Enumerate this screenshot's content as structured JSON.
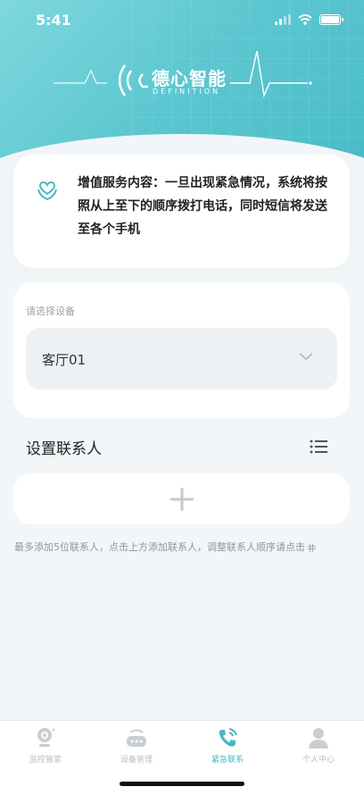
{
  "status_bar": {
    "time": "5:41"
  },
  "brand": {
    "name": "德心智能",
    "subtitle": "DEFINITION"
  },
  "info_card": {
    "text": "增值服务内容：一旦出现紧急情况，系统将按照从上至下的顺序拨打电话，同时短信将发送至各个手机"
  },
  "device": {
    "label": "请选择设备",
    "selected": "客厅01"
  },
  "contacts": {
    "title": "设置联系人",
    "hint": "最多添加5位联系人，点击上方添加联系人，调整联系人顺序请点击"
  },
  "tabs": [
    {
      "label": "监控管家",
      "icon": "camera-icon",
      "active": false
    },
    {
      "label": "设备管理",
      "icon": "device-icon",
      "active": false
    },
    {
      "label": "紧急联系",
      "icon": "phone-icon",
      "active": true
    },
    {
      "label": "个人中心",
      "icon": "user-icon",
      "active": false
    }
  ],
  "colors": {
    "accent": "#46b8c3",
    "header_start": "#7fd8de",
    "header_end": "#45b9c4"
  }
}
